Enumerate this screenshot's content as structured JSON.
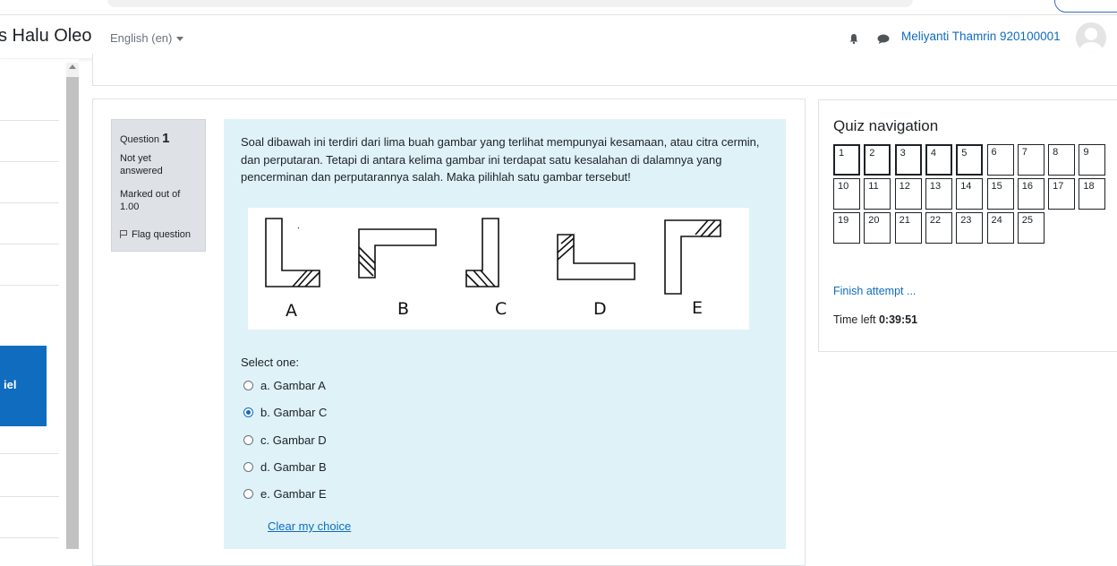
{
  "header": {
    "brand": "s Halu Oleo",
    "language": "English (en)",
    "username": "Meliyanti Thamrin 920100001"
  },
  "sidebar": {
    "active_label": "iel"
  },
  "question": {
    "label": "Question",
    "number": "1",
    "state": "Not yet answered",
    "mark": "Marked out of 1.00",
    "flag": "Flag question",
    "text": "Soal dibawah ini terdiri dari lima buah gambar yang terlihat mempunyai kesamaan, atau citra cermin, dan perputaran. Tetapi di antara kelima gambar ini terdapat satu kesalahan di dalamnya yang pencerminan dan perputarannya salah. Maka pilihlah satu gambar tersebut!",
    "figure_labels": [
      "A",
      "B",
      "C",
      "D",
      "E"
    ],
    "prompt": "Select one:",
    "options": [
      {
        "label": "a. Gambar A",
        "selected": false
      },
      {
        "label": "b. Gambar C",
        "selected": true
      },
      {
        "label": "c. Gambar D",
        "selected": false
      },
      {
        "label": "d. Gambar B",
        "selected": false
      },
      {
        "label": "e. Gambar E",
        "selected": false
      }
    ],
    "clear": "Clear my choice"
  },
  "quiz_nav": {
    "title": "Quiz navigation",
    "buttons": [
      "1",
      "2",
      "3",
      "4",
      "5",
      "6",
      "7",
      "8",
      "9",
      "10",
      "11",
      "12",
      "13",
      "14",
      "15",
      "16",
      "17",
      "18",
      "19",
      "20",
      "21",
      "22",
      "23",
      "24",
      "25"
    ],
    "answered": [
      "1",
      "2",
      "3",
      "4",
      "5"
    ],
    "finish": "Finish attempt ...",
    "time_label": "Time left",
    "time_value": "0:39:51"
  },
  "colors": {
    "accent": "#0f6cbf",
    "formulation_bg": "#def2f8",
    "info_bg": "#dee2e6"
  }
}
